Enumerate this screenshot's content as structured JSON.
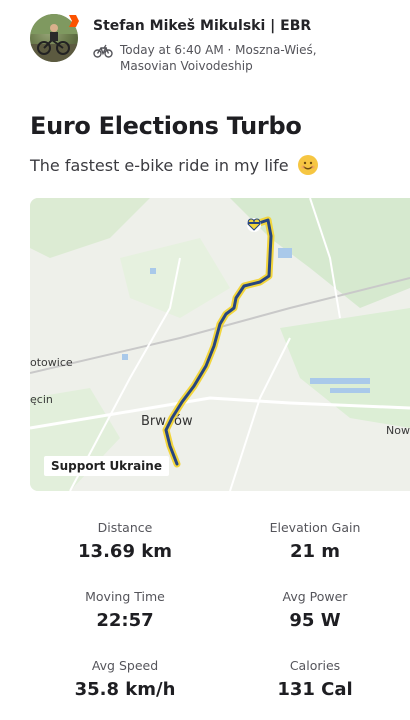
{
  "header": {
    "athlete_name": "Stefan  Mikeš Mikulski | EBR",
    "meta_line1": "Today at 6:40 AM · Moszna-Wieś,",
    "meta_line2": "Masovian Voivodeship",
    "sport_icon": "ebike-icon",
    "badge_color": "#fc5200"
  },
  "activity": {
    "title": "Euro Elections Turbo",
    "description": "The fastest e-bike ride in my life",
    "description_emoji": "smiling-face"
  },
  "map": {
    "place_labels": {
      "otowice": "otowice",
      "cin": "ęcin",
      "brwinow_left": "Brw",
      "brwinow_right": "ów",
      "now": "Now"
    },
    "support_label": "Support Ukraine",
    "route_colors": {
      "outer": "#f2d53c",
      "inner": "#27457f"
    }
  },
  "stats": [
    {
      "label": "Distance",
      "value": "13.69 km"
    },
    {
      "label": "Elevation Gain",
      "value": "21 m"
    },
    {
      "label": "Moving Time",
      "value": "22:57"
    },
    {
      "label": "Avg Power",
      "value": "95 W"
    },
    {
      "label": "Avg Speed",
      "value": "35.8 km/h"
    },
    {
      "label": "Calories",
      "value": "131 Cal"
    }
  ]
}
